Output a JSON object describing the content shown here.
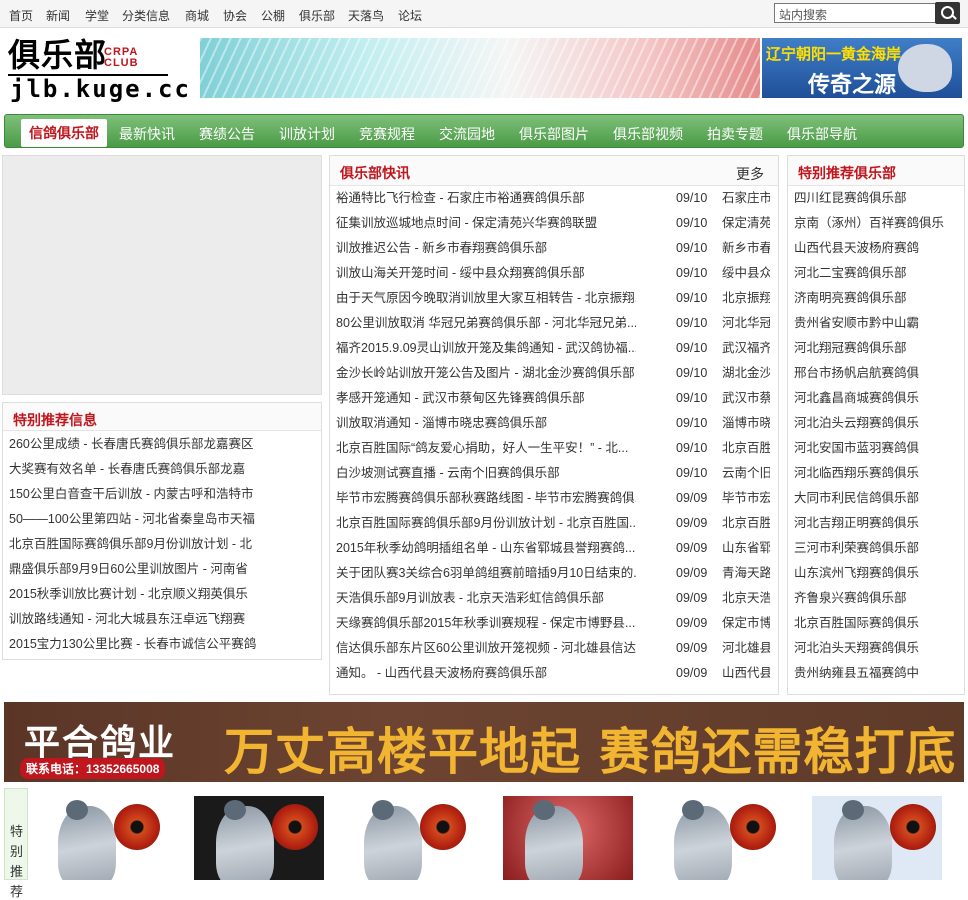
{
  "topnav": [
    "首页",
    "新闻",
    "学堂",
    "分类信息",
    "商城",
    "协会",
    "公棚",
    "俱乐部",
    "天落鸟",
    "论坛"
  ],
  "search": {
    "placeholder": "站内搜索"
  },
  "logo": {
    "main": "俱乐部",
    "sub1": "CRPA",
    "sub2": "CLUB",
    "url": "jlb.kuge.cc"
  },
  "banner_right": {
    "line1": "辽宁朝阳一黄金海岸",
    "line2": "传奇之源"
  },
  "mainnav": [
    "信鸽俱乐部",
    "最新快讯",
    "赛绩公告",
    "训放计划",
    "竞赛规程",
    "交流园地",
    "俱乐部图片",
    "俱乐部视频",
    "拍卖专题",
    "俱乐部导航"
  ],
  "left_info": {
    "title": "特别推荐信息",
    "items": [
      "260公里成绩 - 长春唐氏赛鸽俱乐部龙嘉赛区",
      "大奖赛有效名单 - 长春唐氏赛鸽俱乐部龙嘉",
      "150公里白音查干后训放 - 内蒙古呼和浩特市",
      "50——100公里第四站 - 河北省秦皇岛市天福",
      "北京百胜国际赛鸽俱乐部9月份训放计划 - 北",
      "鼎盛俱乐部9月9日60公里训放图片 - 河南省",
      "2015秋季训放比赛计划 - 北京顺义翔英俱乐",
      "训放路线通知 - 河北大城县东汪卓远飞翔赛",
      "2015宝力130公里比赛 - 长春市诚信公平赛鸽"
    ]
  },
  "news": {
    "title": "俱乐部快讯",
    "more": "更多",
    "items": [
      {
        "t": "裕通特比飞行检查 - 石家庄市裕通赛鸽俱乐部",
        "d": "09/10",
        "s": "石家庄市"
      },
      {
        "t": "征集训放巡城地点时间 - 保定清苑兴华赛鸽联盟",
        "d": "09/10",
        "s": "保定清苑"
      },
      {
        "t": "训放推迟公告 - 新乡市春翔赛鸽俱乐部",
        "d": "09/10",
        "s": "新乡市春"
      },
      {
        "t": "训放山海关开笼时间 - 绥中县众翔赛鸽俱乐部",
        "d": "09/10",
        "s": "绥中县众"
      },
      {
        "t": "由于天气原因今晚取消训放里大家互相转告 - 北京振翔...",
        "d": "09/10",
        "s": "北京振翔"
      },
      {
        "t": "80公里训放取消 华冠兄弟赛鸽俱乐部 - 河北华冠兄弟...",
        "d": "09/10",
        "s": "河北华冠"
      },
      {
        "t": "福齐2015.9.09灵山训放开笼及集鸽通知 - 武汉鸽协福...",
        "d": "09/10",
        "s": "武汉福齐"
      },
      {
        "t": "金沙长岭站训放开笼公告及图片 - 湖北金沙赛鸽俱乐部",
        "d": "09/10",
        "s": "湖北金沙"
      },
      {
        "t": "孝感开笼通知 - 武汉市蔡甸区先锋赛鸽俱乐部",
        "d": "09/10",
        "s": "武汉市蔡"
      },
      {
        "t": "训放取消通知 - 淄博市晓忠赛鸽俱乐部",
        "d": "09/10",
        "s": "淄博市晓"
      },
      {
        "t": "北京百胜国际“鸽友爱心捐助，好人一生平安！” - 北...",
        "d": "09/10",
        "s": "北京百胜"
      },
      {
        "t": "白沙坡测试赛直播 - 云南个旧赛鸽俱乐部",
        "d": "09/10",
        "s": "云南个旧"
      },
      {
        "t": "毕节市宏腾赛鸽俱乐部秋赛路线图 - 毕节市宏腾赛鸽俱...",
        "d": "09/09",
        "s": "毕节市宏"
      },
      {
        "t": "北京百胜国际赛鸽俱乐部9月份训放计划 - 北京百胜国...",
        "d": "09/09",
        "s": "北京百胜"
      },
      {
        "t": "2015年秋季幼鸽明插组名单 - 山东省郓城县誉翔赛鸽...",
        "d": "09/09",
        "s": "山东省郓"
      },
      {
        "t": "关于团队赛3关综合6羽单鸽组赛前暗插9月10日结束的...",
        "d": "09/09",
        "s": "青海天路"
      },
      {
        "t": "天浩俱乐部9月训放表 - 北京天浩彩虹信鸽俱乐部",
        "d": "09/09",
        "s": "北京天浩"
      },
      {
        "t": "天缘赛鸽俱乐部2015年秋季训赛规程 - 保定市博野县...",
        "d": "09/09",
        "s": "保定市博"
      },
      {
        "t": "信达俱乐部东片区60公里训放开笼视频 - 河北雄县信达...",
        "d": "09/09",
        "s": "河北雄县"
      },
      {
        "t": "通知。 - 山西代县天波杨府赛鸽俱乐部",
        "d": "09/09",
        "s": "山西代县"
      }
    ]
  },
  "right_clubs": {
    "title": "特别推荐俱乐部",
    "items": [
      "四川红昆赛鸽俱乐部",
      "京南（涿州）百祥赛鸽俱乐",
      "山西代县天波杨府赛鸽",
      "河北二宝赛鸽俱乐部",
      "济南明亮赛鸽俱乐部",
      "贵州省安顺市黔中山霸",
      "河北翔冠赛鸽俱乐部",
      "邢台市扬帆启航赛鸽俱",
      "河北鑫昌商城赛鸽俱乐",
      "河北泊头云翔赛鸽俱乐",
      "河北安国市蓝羽赛鸽俱",
      "河北临西翔乐赛鸽俱乐",
      "大同市利民信鸽俱乐部",
      "河北吉翔正明赛鸽俱乐",
      "三河市利荣赛鸽俱乐部",
      "山东滨州飞翔赛鸽俱乐",
      "齐鲁泉兴赛鸽俱乐部",
      "北京百胜国际赛鸽俱乐",
      "河北泊头天翔赛鸽俱乐",
      "贵州纳雍县五福赛鸽中"
    ]
  },
  "ad": {
    "brand": "平合鸽业",
    "phone": "联系电话：13352665008",
    "slogan": "万丈高楼平地起 赛鸽还需稳打底"
  },
  "rec_label": [
    "特",
    "别",
    "推",
    "荐"
  ]
}
